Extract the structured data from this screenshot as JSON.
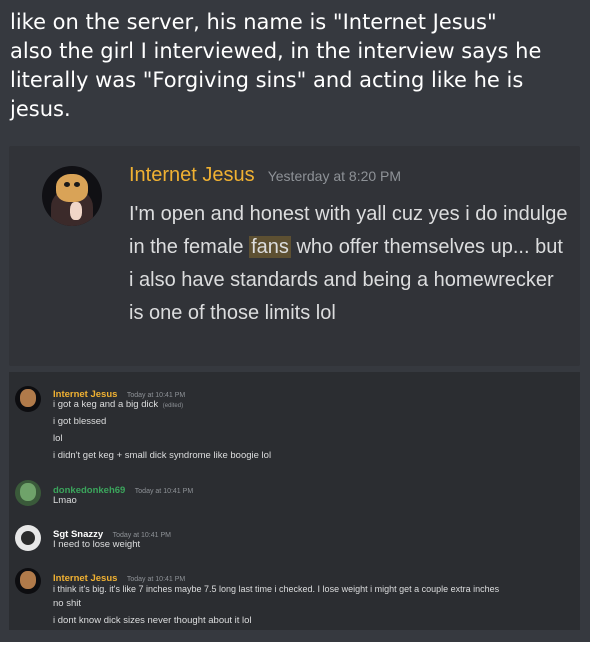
{
  "caption": {
    "line1": "like on the server, his name is \"Internet Jesus\"",
    "line2": "also the girl I interviewed, in the interview says he",
    "line3": "literally was \"Forgiving sins\" and acting like he is",
    "line4": "jesus."
  },
  "quoted_message": {
    "username": "Internet Jesus",
    "timestamp": "Yesterday at 8:20 PM",
    "body_part1": "I'm open and honest with yall cuz yes i do indulge in the female ",
    "highlight": "fans",
    "body_part2": " who offer themselves up... but i also have standards and being a homewrecker is one of those limits lol",
    "username_color": "#f0b132",
    "highlight_color": "#5d5032"
  },
  "chat": {
    "messages": [
      {
        "username": "Internet Jesus",
        "timestamp": "Today at 10:41 PM",
        "username_color": "#f0b132",
        "lines": [
          "i got a keg and a big dick",
          "i got blessed",
          "lol",
          "i didn't get keg + small dick syndrome like boogie lol"
        ],
        "edited_tag": "(edited)"
      },
      {
        "username": "donkedonkeh69",
        "timestamp": "Today at 10:41 PM",
        "username_color": "#3ba55c",
        "lines": [
          "Lmao"
        ]
      },
      {
        "username": "Sgt Snazzy",
        "timestamp": "Today at 10:41 PM",
        "username_color": "#ffffff",
        "lines": [
          "I need to lose weight"
        ]
      },
      {
        "username": "Internet Jesus",
        "timestamp": "Today at 10:41 PM",
        "username_color": "#f0b132",
        "lines": [
          "i think it's big. it's like 7 inches maybe 7.5 long last time i checked. I lose weight i might get a couple extra inches",
          "no shit",
          "i dont know dick sizes never thought about it lol"
        ]
      }
    ]
  }
}
